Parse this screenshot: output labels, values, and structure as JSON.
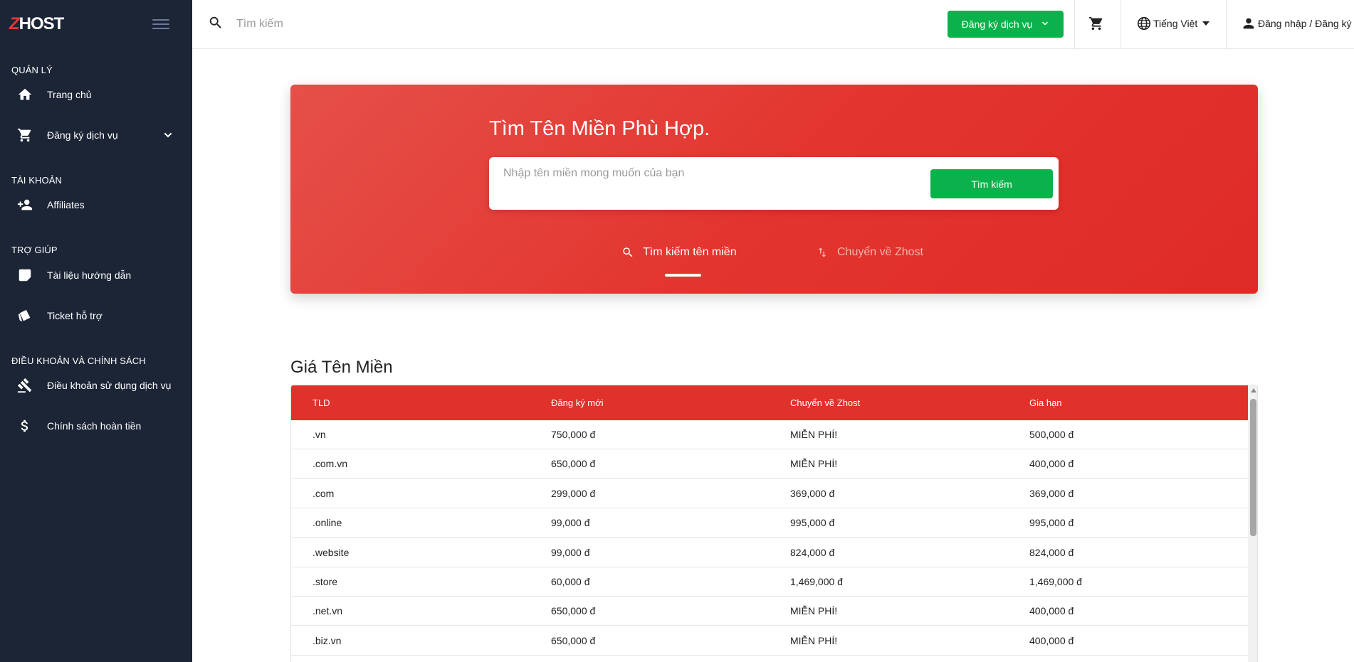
{
  "brand": {
    "logo_z": "Z",
    "logo_rest": "HOST"
  },
  "sidebar": {
    "sections": [
      {
        "title": "QUẢN LÝ",
        "items": [
          {
            "label": "Trang chủ",
            "icon": "home-icon"
          },
          {
            "label": "Đăng ký dịch vụ",
            "icon": "cart-icon"
          }
        ]
      },
      {
        "title": "TÀI KHOẢN",
        "items": [
          {
            "label": "Affiliates",
            "icon": "add-user-icon"
          }
        ]
      },
      {
        "title": "TRỢ GIÚP",
        "items": [
          {
            "label": "Tài liệu hướng dẫn",
            "icon": "note-icon"
          },
          {
            "label": "Ticket hỗ trợ",
            "icon": "ticket-icon"
          }
        ]
      },
      {
        "title": "ĐIỀU KHOẢN VÀ CHÍNH SÁCH",
        "items": [
          {
            "label": "Điều khoản sử dụng dịch vụ",
            "icon": "gavel-icon"
          },
          {
            "label": "Chính sách hoàn tiền",
            "icon": "dollar-icon"
          }
        ]
      }
    ]
  },
  "header": {
    "search_placeholder": "Tìm kiếm",
    "register_button": "Đăng ký dịch vụ",
    "language": "Tiếng Việt",
    "login": "Đăng nhập / Đăng ký"
  },
  "hero": {
    "title": "Tìm Tên Miền Phù Hợp.",
    "input_placeholder": "Nhập tên miền mong muốn của bạn",
    "search_button": "Tìm kiếm",
    "tabs": [
      {
        "label": "Tìm kiếm tên miền",
        "active": true
      },
      {
        "label": "Chuyển về Zhost",
        "active": false
      }
    ]
  },
  "pricing": {
    "title": "Giá Tên Miền",
    "columns": [
      "TLD",
      "Đăng ký mới",
      "Chuyển về Zhost",
      "Gia hạn"
    ],
    "rows": [
      [
        ".vn",
        "750,000 đ",
        "MIỄN PHÍ!",
        "500,000 đ"
      ],
      [
        ".com.vn",
        "650,000 đ",
        "MIỄN PHÍ!",
        "400,000 đ"
      ],
      [
        ".com",
        "299,000 đ",
        "369,000 đ",
        "369,000 đ"
      ],
      [
        ".online",
        "99,000 đ",
        "995,000 đ",
        "995,000 đ"
      ],
      [
        ".website",
        "99,000 đ",
        "824,000 đ",
        "824,000 đ"
      ],
      [
        ".store",
        "60,000 đ",
        "1,469,000 đ",
        "1,469,000 đ"
      ],
      [
        ".net.vn",
        "650,000 đ",
        "MIỄN PHÍ!",
        "400,000 đ"
      ],
      [
        ".biz.vn",
        "650,000 đ",
        "MIỄN PHÍ!",
        "400,000 đ"
      ]
    ]
  },
  "colors": {
    "sidebar_bg": "#1c2536",
    "accent_red": "#e0312b",
    "accent_green": "#0bb24b"
  }
}
